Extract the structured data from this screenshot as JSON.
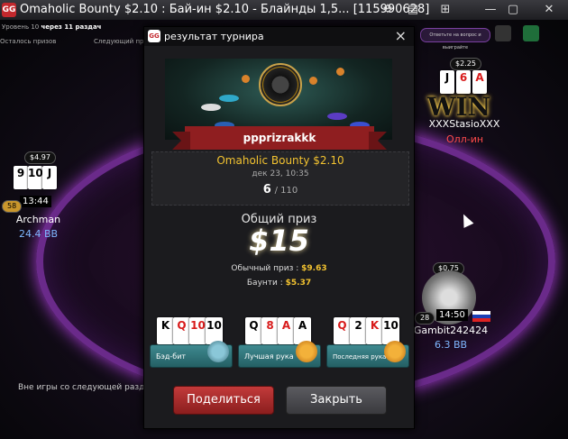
{
  "window": {
    "title": "Omaholic Bounty $2.10 : Бай-ин $2.10 - Блайнды 1,5... [115990628]",
    "logo": "GG"
  },
  "table": {
    "level_prefix": "Уровень 10",
    "level_next": "через 11 раздач",
    "level_note": "Осталось призов",
    "next_note": "Следующий приз",
    "promo_text": "Ответьте на вопрос и выиграйте",
    "bottom_status": "Вне игры со следующей раздачи",
    "players": [
      {
        "name": "Archman",
        "stack": "24.4 BB",
        "bet": "$4.97",
        "cards": [
          "9",
          "10",
          "J"
        ],
        "timer": "13:44",
        "badge": "58"
      },
      {
        "name": "XXXStasioXXX",
        "status": "Олл-ин",
        "bet": "$2.25",
        "cards": [
          "J",
          "6",
          "A"
        ],
        "overlay": "WIN"
      },
      {
        "name": "Gambit242424",
        "stack": "6.3 BB",
        "bet": "$0.75",
        "timer": "14:50",
        "badge": "28"
      }
    ]
  },
  "modal": {
    "title": "результат турнира",
    "close_icon": "×",
    "winner": "ppprizrakkk",
    "tournament_name": "Omaholic Bounty $2.10",
    "date": "дек 23, 10:35",
    "place": "6",
    "total_players": "/ 110",
    "total_prize_label": "Общий приз",
    "total_prize_value": "$15",
    "regular_prize_label": "Обычный приз :",
    "regular_prize_value": "$9.63",
    "bounty_label": "Баунти :",
    "bounty_value": "$5.37",
    "awards": [
      {
        "label": "Бэд-бит",
        "cards": [
          "K",
          "Q",
          "10",
          "10"
        ]
      },
      {
        "label": "Лучшая рука",
        "cards": [
          "Q",
          "8",
          "A",
          "A"
        ]
      },
      {
        "label": "Последняя рука",
        "cards": [
          "Q",
          "2",
          "K",
          "10"
        ]
      }
    ],
    "share_label": "Поделиться",
    "close_label": "Закрыть"
  },
  "colors": {
    "accent_gold": "#f2c230",
    "share_red": "#a82828",
    "felt_purple": "#6a2a8a"
  }
}
